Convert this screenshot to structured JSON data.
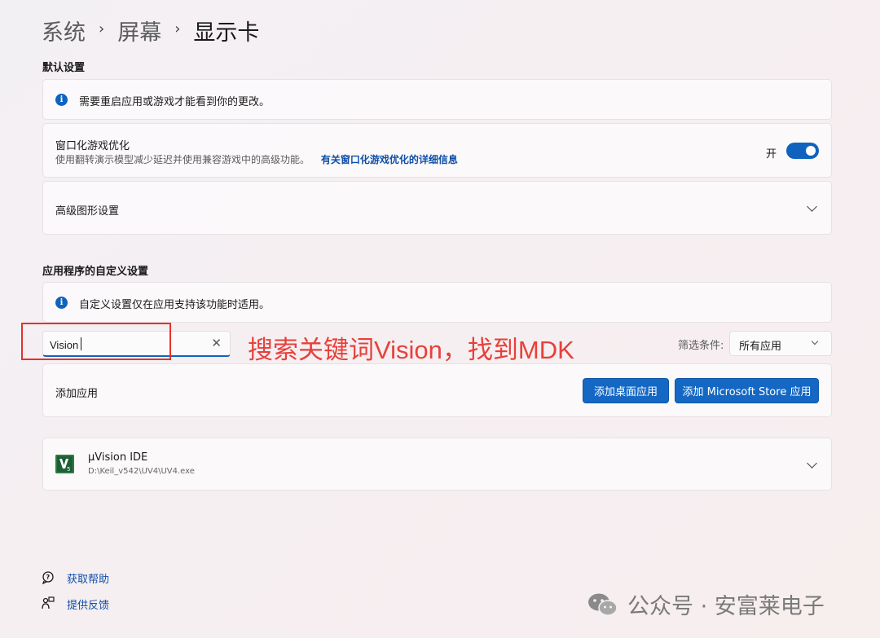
{
  "breadcrumb": {
    "items": [
      "系统",
      "屏幕",
      "显示卡"
    ],
    "separator": "›"
  },
  "default_settings": {
    "title": "默认设置",
    "info_text": "需要重启应用或游戏才能看到你的更改。",
    "windowed_opt": {
      "title": "窗口化游戏优化",
      "description": "使用翻转演示模型减少延迟并使用兼容游戏中的高级功能。",
      "link": "有关窗口化游戏优化的详细信息",
      "toggle_label": "开",
      "toggle_on": true
    },
    "advanced_graphics": "高级图形设置"
  },
  "app_settings": {
    "title": "应用程序的自定义设置",
    "info_text": "自定义设置仅在应用支持该功能时适用。",
    "search": {
      "value": "Vision",
      "clear_icon": "close-icon"
    },
    "annotation": "搜索关键词Vision，找到MDK",
    "filter": {
      "label": "筛选条件:",
      "value": "所有应用"
    },
    "add_app": {
      "label": "添加应用",
      "desktop_button": "添加桌面应用",
      "store_button": "添加 Microsoft Store 应用"
    },
    "apps": [
      {
        "name": "µVision IDE",
        "path": "D:\\Keil_v542\\UV4\\UV4.exe"
      }
    ]
  },
  "footer": {
    "help": "获取帮助",
    "feedback": "提供反馈"
  },
  "watermark": "公众号 · 安富莱电子",
  "colors": {
    "accent": "#0f63be",
    "annotation_red": "#e8403a",
    "link": "#0f4fa8"
  }
}
